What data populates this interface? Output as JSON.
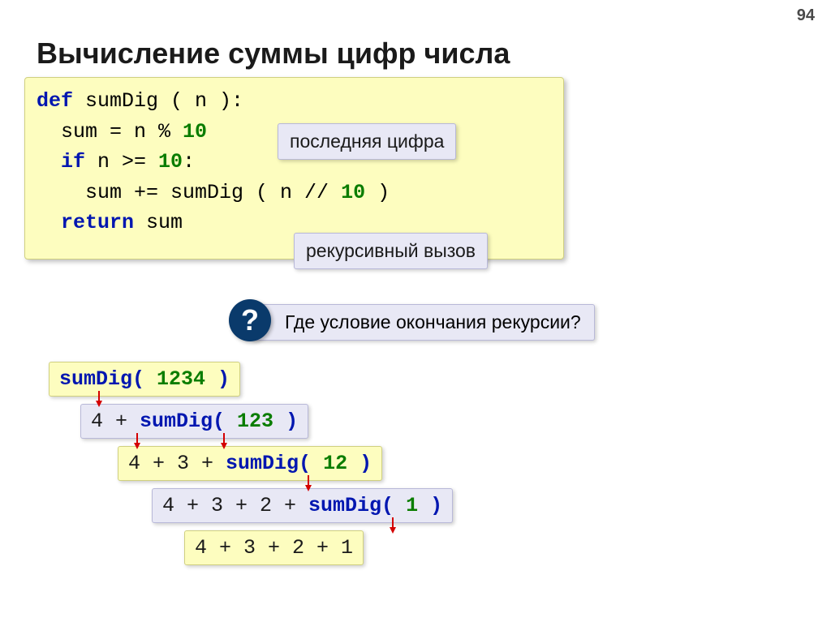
{
  "page_number": "94",
  "title": "Вычисление суммы цифр числа",
  "code": {
    "l1_def": "def",
    "l1_fn": " sumDig ( n ):",
    "l2a": "  sum = n % ",
    "l2b": "10",
    "l3a": "  ",
    "l3_if": "if",
    "l3b": " n >= ",
    "l3c": "10",
    "l3d": ":",
    "l4a": "    sum += sumDig ( n // ",
    "l4b": "10",
    "l4c": " )",
    "l5a": "  ",
    "l5_ret": "return",
    "l5b": " sum"
  },
  "callouts": {
    "last_digit": "последняя цифра",
    "recursive_call": "рекурсивный вызов"
  },
  "question": {
    "mark": "?",
    "text": "Где условие окончания рекурсии?"
  },
  "steps": {
    "s1_fn": "sumDig(",
    "s1_arg": " 1234 ",
    "s1_cl": ")",
    "s2_pre": "4 + ",
    "s2_fn": "sumDig(",
    "s2_arg": " 123 ",
    "s2_cl": ")",
    "s3_pre": "4 + 3 + ",
    "s3_fn": "sumDig(",
    "s3_arg": " 12 ",
    "s3_cl": ")",
    "s4_pre": "4 + 3 + 2 + ",
    "s4_fn": "sumDig(",
    "s4_arg": " 1 ",
    "s4_cl": ")",
    "s5": "4 + 3 + 2 + 1"
  }
}
